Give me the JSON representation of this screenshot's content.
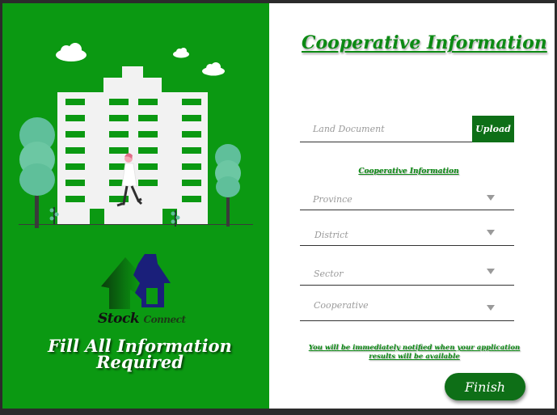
{
  "left_panel": {
    "brand": {
      "stock": "Stock",
      "connect": "Connect"
    },
    "heading_line1": "Fill All Information",
    "heading_line2": "Required"
  },
  "form": {
    "title": "Cooperative Information",
    "land_document_placeholder": "Land Document",
    "upload_label": "Upload",
    "section_label": "Cooperative Information",
    "province_placeholder": "Province",
    "district_placeholder": "District",
    "sector_placeholder": "Sector",
    "cooperative_placeholder": "Cooperative",
    "notice": "You will be immediately notified when your application results will be available",
    "finish_label": "Finish"
  },
  "colors": {
    "panel_green": "#0b9912",
    "button_green": "#0e6f17",
    "title_green": "#0c8a14"
  }
}
